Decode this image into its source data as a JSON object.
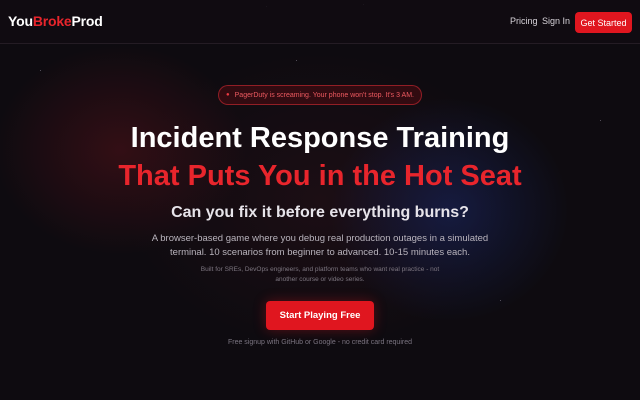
{
  "brand": {
    "part1": "You",
    "part2": "Broke",
    "part3": "Prod"
  },
  "nav": {
    "links": [
      {
        "label": "Pricing"
      },
      {
        "label": "Sign In"
      }
    ],
    "cta_label": "Get Started"
  },
  "hero": {
    "alert_icon": "alert-dot-icon",
    "alert_text": "PagerDuty is screaming. Your phone won't stop. It's 3 AM.",
    "title_line1": "Incident Response Training",
    "title_line2": "That Puts You in the Hot Seat",
    "subtitle": "Can you fix it before everything burns?",
    "description": "A browser-based game where you debug real production outages in a simulated terminal. 10 scenarios from beginner to advanced. 10-15 minutes each.",
    "audience_note": "Built for SREs, DevOps engineers, and platform teams who want real practice - not another course or video series.",
    "cta_label": "Start Playing Free",
    "footnote": "Free signup with GitHub or Google - no credit card required"
  },
  "colors": {
    "accent": "#e0161f",
    "brand_red": "#e8252c",
    "background": "#0e0b10"
  }
}
